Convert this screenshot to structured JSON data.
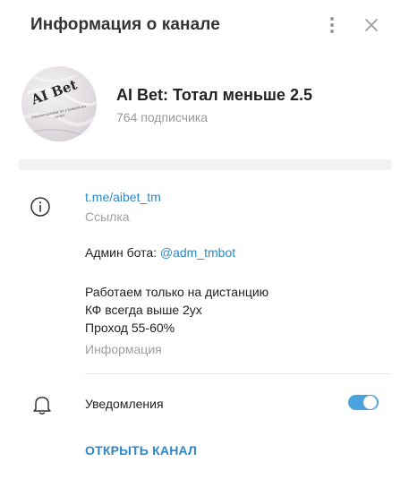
{
  "header": {
    "title": "Информация о канале",
    "menu_icon": "more-vertical-icon",
    "close_icon": "close-icon"
  },
  "channel": {
    "name": "AI Bet: Тотал меньше 2.5",
    "subscribers": "764 подписчика",
    "avatar": {
      "logo_text": "AI Bet",
      "caption": "Рекомендации по ставкам на спорт"
    }
  },
  "info": {
    "icon": "info-icon",
    "link": "t.me/aibet_tm",
    "link_caption": "Ссылка",
    "admin_prefix": "Админ бота: ",
    "admin_handle": "@adm_tmbot",
    "about_lines": [
      "Работаем только на дистанцию",
      "КФ всегда выше 2ух",
      "Проход 55-60%"
    ],
    "about_caption": "Информация"
  },
  "notifications": {
    "icon": "bell-icon",
    "label": "Уведомления",
    "enabled": true
  },
  "actions": {
    "open_channel": "ОТКРЫТЬ КАНАЛ"
  },
  "colors": {
    "accent": "#2c87c8",
    "toggle": "#4aa3df",
    "muted": "#999999"
  }
}
